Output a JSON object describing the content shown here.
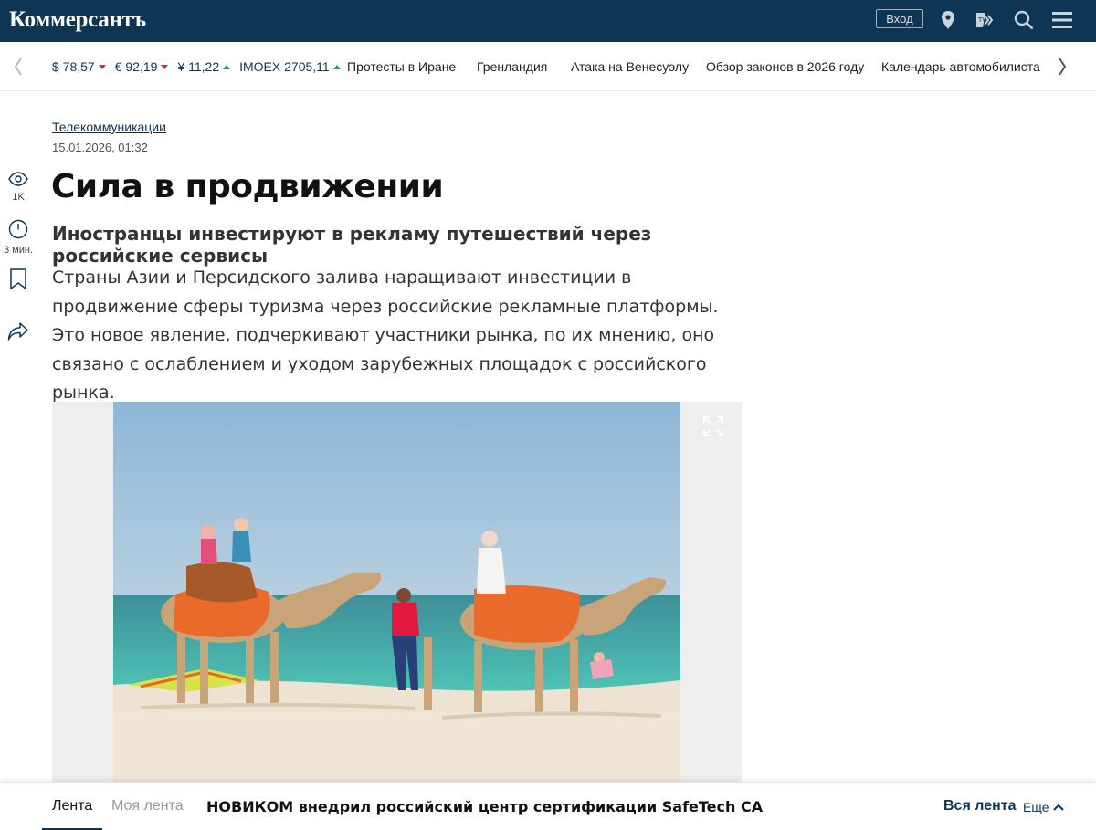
{
  "header": {
    "logo": "Коммерсантъ",
    "login_label": "Вход",
    "icons": [
      "location-pin-icon",
      "tv-fm-icon",
      "search-icon",
      "menu-icon"
    ],
    "bg_color": "#0f3555"
  },
  "ticker": {
    "rates": [
      {
        "label": "$ 78,57",
        "trend": "down"
      },
      {
        "label": "€ 92,19",
        "trend": "down"
      },
      {
        "label": "¥ 11,22",
        "trend": "up"
      },
      {
        "label": "IMOEX 2705,11",
        "trend": "up"
      }
    ],
    "topics": [
      "Протесты в Иране",
      "Гренландия",
      "Атака на Венесуэлу",
      "Обзор законов в 2026 году",
      "Календарь автомобилиста"
    ],
    "trend_colors": {
      "down": "#d7263d",
      "up": "#2e9b4a"
    }
  },
  "sidebar": {
    "views": "1K",
    "read_time": "3 мин."
  },
  "article": {
    "rubric": "Телекоммуникации",
    "date": "15.01.2026, 01:32",
    "title": "Сила в продвижении",
    "subtitle": "Иностранцы инвестируют в рекламу путешествий через российские сервисы",
    "lead": "Страны Азии и Персидского залива наращивают инвестиции в продвижение сферы туризма через российские рекламные платформы. Это новое явление, подчеркивают участники рынка, по их мнению, оно связано с ослаблением и уходом зарубежных площадок с российского рынка."
  },
  "bottom_bar": {
    "tab_feed": "Лента",
    "tab_my_feed": "Моя лента",
    "headline": "НОВИКОМ внедрил российский центр сертификации SafeTech CA",
    "all_feed": "Вся лента",
    "more": "Еще"
  }
}
